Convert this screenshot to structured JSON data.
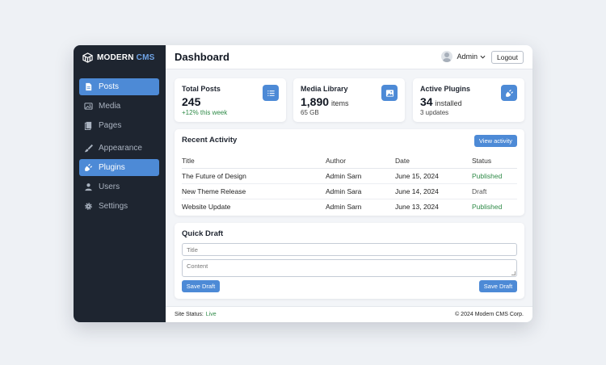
{
  "brand": {
    "name": "MODERN",
    "accent": "CMS"
  },
  "sidebar": {
    "items": [
      {
        "label": "Posts",
        "icon": "document-icon",
        "active": true
      },
      {
        "label": "Media",
        "icon": "image-icon",
        "active": false
      },
      {
        "label": "Pages",
        "icon": "pages-icon",
        "active": false
      },
      {
        "label": "Appearance",
        "icon": "brush-icon",
        "active": false
      },
      {
        "label": "Plugins",
        "icon": "plug-icon",
        "active": true
      },
      {
        "label": "Users",
        "icon": "user-icon",
        "active": false
      },
      {
        "label": "Settings",
        "icon": "gear-icon",
        "active": false
      }
    ]
  },
  "header": {
    "title": "Dashboard",
    "user": "Admin",
    "logout_label": "Logout"
  },
  "stats": [
    {
      "label": "Total Posts",
      "value": "245",
      "unit": "",
      "sub": "+12% this week",
      "icon": "list-icon"
    },
    {
      "label": "Media Library",
      "value": "1,890",
      "unit": "items",
      "sub": "65 GB",
      "icon": "image-icon"
    },
    {
      "label": "Active Plugins",
      "value": "34",
      "unit": "installed",
      "sub": "3 updates",
      "icon": "plug-icon"
    }
  ],
  "activity": {
    "title": "Recent Activity",
    "button_label": "View activity",
    "columns": [
      "Title",
      "Author",
      "Date",
      "Status"
    ],
    "rows": [
      {
        "title": "The Future of Design",
        "author": "Admin Sarn",
        "date": "June 15, 2024",
        "status": "Published"
      },
      {
        "title": "New Theme Release",
        "author": "Admin Sara",
        "date": "June 14, 2024",
        "status": "Draft"
      },
      {
        "title": "Website Update",
        "author": "Admin Sarn",
        "date": "June 13, 2024",
        "status": "Published"
      }
    ]
  },
  "quick_draft": {
    "title": "Quick Draft",
    "title_placeholder": "Title",
    "content_placeholder": "Content",
    "save_label": "Save Draft",
    "save_label_right": "Save Draft"
  },
  "footer": {
    "status_label": "Site Status:",
    "status_value": "Live",
    "copyright": "© 2024 Modern CMS Corp."
  },
  "colors": {
    "accent": "#4d8ad6",
    "sidebar_bg": "#1e2530",
    "success": "#2e8a47"
  }
}
